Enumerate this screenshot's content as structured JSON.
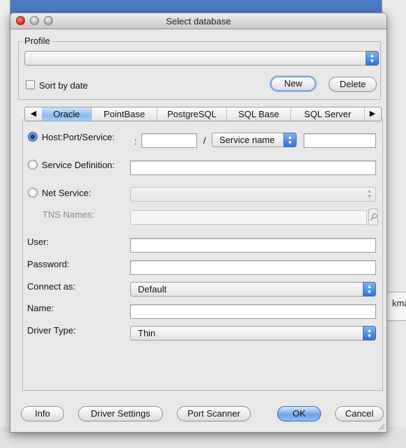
{
  "window": {
    "title": "Select database"
  },
  "profile": {
    "legend": "Profile",
    "selected": "",
    "sort_by_date_label": "Sort by date",
    "sort_by_date_checked": false,
    "new_label": "New",
    "delete_label": "Delete"
  },
  "tabs": {
    "items": [
      "Oracle",
      "PointBase",
      "PostgreSQL",
      "SQL Base",
      "SQL Server"
    ],
    "selected": "Oracle"
  },
  "connection": {
    "host_port_service_label": "Host:Port/Service:",
    "colon": ":",
    "slash": "/",
    "service_type": "Service name",
    "host_value": "",
    "service_value": "",
    "service_definition_label": "Service Definition:",
    "service_definition_value": "",
    "net_service_label": "Net Service:",
    "net_service_value": "",
    "tns_names_label": "TNS Names:",
    "tns_names_value": "",
    "selected_mode": "Host:Port/Service:"
  },
  "credentials": {
    "user_label": "User:",
    "user_value": "",
    "password_label": "Password:",
    "password_value": "",
    "connect_as_label": "Connect as:",
    "connect_as_value": "Default",
    "name_label": "Name:",
    "name_value": "",
    "driver_type_label": "Driver Type:",
    "driver_type_value": "Thin"
  },
  "footer": {
    "info_label": "Info",
    "driver_settings_label": "Driver Settings",
    "port_scanner_label": "Port Scanner",
    "ok_label": "OK",
    "cancel_label": "Cancel"
  },
  "background": {
    "partial_text": "kma"
  }
}
